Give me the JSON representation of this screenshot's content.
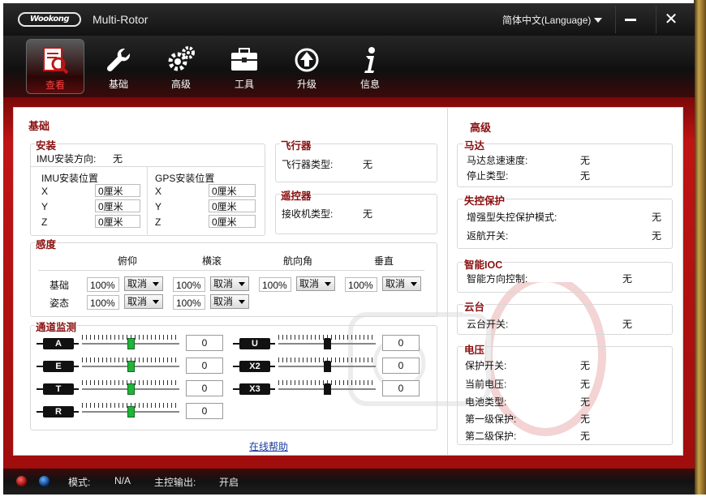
{
  "window": {
    "logo_text": "Wookong",
    "title": "Multi-Rotor",
    "language": "简体中文(Language)"
  },
  "toolbar": {
    "items": [
      {
        "label": "查看",
        "icon": "view-icon",
        "active": true
      },
      {
        "label": "基础",
        "icon": "wrench-icon"
      },
      {
        "label": "高级",
        "icon": "gears-icon"
      },
      {
        "label": "工具",
        "icon": "toolbox-icon"
      },
      {
        "label": "升级",
        "icon": "upgrade-icon"
      },
      {
        "label": "信息",
        "icon": "info-icon"
      }
    ]
  },
  "basic": {
    "title": "基础",
    "install": {
      "title": "安装",
      "imu_dir_label": "IMU安装方向:",
      "imu_dir_value": "无",
      "imu_pos_title": "IMU安装位置",
      "gps_pos_title": "GPS安装位置",
      "imu_pos": [
        {
          "axis": "X",
          "value": "0厘米"
        },
        {
          "axis": "Y",
          "value": "0厘米"
        },
        {
          "axis": "Z",
          "value": "0厘米"
        }
      ],
      "gps_pos": [
        {
          "axis": "X",
          "value": "0厘米"
        },
        {
          "axis": "Y",
          "value": "0厘米"
        },
        {
          "axis": "Z",
          "value": "0厘米"
        }
      ]
    },
    "aircraft": {
      "title": "飞行器",
      "type_label": "飞行器类型:",
      "type_value": "无"
    },
    "remote": {
      "title": "遥控器",
      "rx_label": "接收机类型:",
      "rx_value": "无"
    },
    "gain": {
      "title": "感度",
      "columns": [
        "俯仰",
        "横滚",
        "航向角",
        "垂直"
      ],
      "rows": [
        {
          "label": "基础",
          "cells": [
            {
              "value": "100%",
              "option": "取消"
            },
            {
              "value": "100%",
              "option": "取消"
            },
            {
              "value": "100%",
              "option": "取消"
            },
            {
              "value": "100%",
              "option": "取消"
            }
          ]
        },
        {
          "label": "姿态",
          "cells": [
            {
              "value": "100%",
              "option": "取消"
            },
            {
              "value": "100%",
              "option": "取消"
            }
          ]
        }
      ]
    },
    "channels": {
      "title": "通道监测",
      "left": [
        {
          "name": "A",
          "value": "0",
          "level": 0.5
        },
        {
          "name": "E",
          "value": "0",
          "level": 0.5
        },
        {
          "name": "T",
          "value": "0",
          "level": 0.5
        },
        {
          "name": "R",
          "value": "0",
          "level": 0.5
        }
      ],
      "right": [
        {
          "name": "U",
          "value": "0",
          "level": 0.5
        },
        {
          "name": "X2",
          "value": "0",
          "level": 0.5
        },
        {
          "name": "X3",
          "value": "0",
          "level": 0.5
        }
      ]
    },
    "help_link": "在线帮助"
  },
  "advanced": {
    "title": "高级",
    "motor": {
      "title": "马达",
      "rows": [
        {
          "label": "马达怠速速度:",
          "value": "无"
        },
        {
          "label": "停止类型:",
          "value": "无"
        }
      ]
    },
    "failsafe": {
      "title": "失控保护",
      "rows": [
        {
          "label": "增强型失控保护模式:",
          "value": "无"
        },
        {
          "label": "返航开关:",
          "value": "无"
        }
      ]
    },
    "ioc": {
      "title": "智能IOC",
      "rows": [
        {
          "label": "智能方向控制:",
          "value": "无"
        }
      ]
    },
    "gimbal": {
      "title": "云台",
      "rows": [
        {
          "label": "云台开关:",
          "value": "无"
        }
      ]
    },
    "voltage": {
      "title": "电压",
      "rows": [
        {
          "label": "保护开关:",
          "value": "无"
        },
        {
          "label": "当前电压:",
          "value": "无"
        },
        {
          "label": "电池类型:",
          "value": "无"
        },
        {
          "label": "第一级保护:",
          "value": "无"
        },
        {
          "label": "第二级保护:",
          "value": "无"
        }
      ]
    }
  },
  "status": {
    "mode_label": "模式:",
    "mode_value": "N/A",
    "output_label": "主控输出:",
    "output_value": "开启"
  },
  "colors": {
    "accent": "#8a0f0f",
    "band": "#c01414",
    "slider_knob": "#22b33a"
  }
}
